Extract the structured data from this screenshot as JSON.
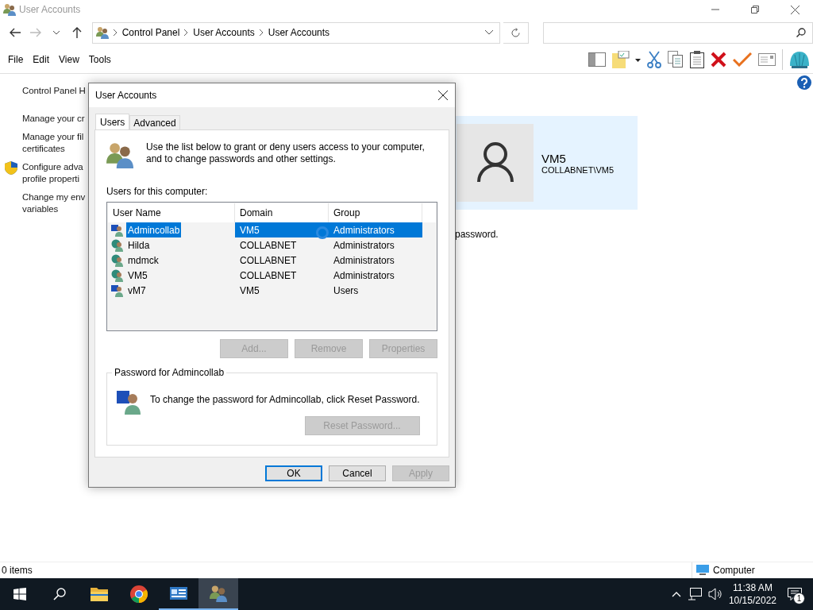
{
  "window": {
    "title": "User Accounts"
  },
  "address_bar": {
    "breadcrumbs": [
      "Control Panel",
      "User Accounts",
      "User Accounts"
    ]
  },
  "menu": [
    "File",
    "Edit",
    "View",
    "Tools"
  ],
  "sidebar": {
    "items": [
      {
        "kind": "heading",
        "lines": [
          "Control Panel H"
        ]
      },
      {
        "kind": "link",
        "lines": [
          "Manage your cr"
        ]
      },
      {
        "kind": "link",
        "lines": [
          "Manage your fil",
          "certificates"
        ]
      },
      {
        "kind": "shield",
        "lines": [
          "Configure adva",
          "profile properti"
        ]
      },
      {
        "kind": "link",
        "lines": [
          "Change my env",
          "variables"
        ]
      }
    ]
  },
  "account_card": {
    "name": "VM5",
    "account": "COLLABNET\\VM5"
  },
  "partial_text": "password.",
  "dialog": {
    "title": "User Accounts",
    "tabs": [
      {
        "label": "Users",
        "selected": true
      },
      {
        "label": "Advanced",
        "selected": false
      }
    ],
    "intro": "Use the list below to grant or deny users access to your computer, and to change passwords and other settings.",
    "list_label": "Users for this computer:",
    "columns": [
      "User Name",
      "Domain",
      "Group"
    ],
    "rows": [
      {
        "kind": "local",
        "name": "Admincollab",
        "domain": "VM5",
        "group": "Administrators",
        "selected": true
      },
      {
        "kind": "domain",
        "name": "Hilda",
        "domain": "COLLABNET",
        "group": "Administrators",
        "selected": false
      },
      {
        "kind": "domain",
        "name": "mdmck",
        "domain": "COLLABNET",
        "group": "Administrators",
        "selected": false
      },
      {
        "kind": "domain",
        "name": "VM5",
        "domain": "COLLABNET",
        "group": "Administrators",
        "selected": false
      },
      {
        "kind": "local",
        "name": "vM7",
        "domain": "VM5",
        "group": "Users",
        "selected": false
      }
    ],
    "list_buttons": [
      {
        "label": "Add...",
        "disabled": true
      },
      {
        "label": "Remove",
        "disabled": true
      },
      {
        "label": "Properties",
        "disabled": true
      }
    ],
    "password_group": {
      "title": "Password for Admincollab",
      "text": "To change the password for Admincollab, click Reset Password.",
      "button": {
        "label": "Reset Password...",
        "disabled": true
      }
    },
    "buttons": [
      {
        "label": "OK",
        "default": true,
        "disabled": false
      },
      {
        "label": "Cancel",
        "default": false,
        "disabled": false
      },
      {
        "label": "Apply",
        "default": false,
        "disabled": true
      }
    ]
  },
  "status_bar": {
    "left": "0 items",
    "right": "Computer"
  },
  "taskbar": {
    "apps": [
      {
        "kind": "folder",
        "running": false,
        "active": false
      },
      {
        "kind": "browser",
        "running": false,
        "active": false
      },
      {
        "kind": "panel",
        "running": true,
        "active": false
      },
      {
        "kind": "users",
        "running": true,
        "active": true
      }
    ],
    "time": "11:38 AM",
    "date": "10/15/2022",
    "notifications": "1"
  }
}
